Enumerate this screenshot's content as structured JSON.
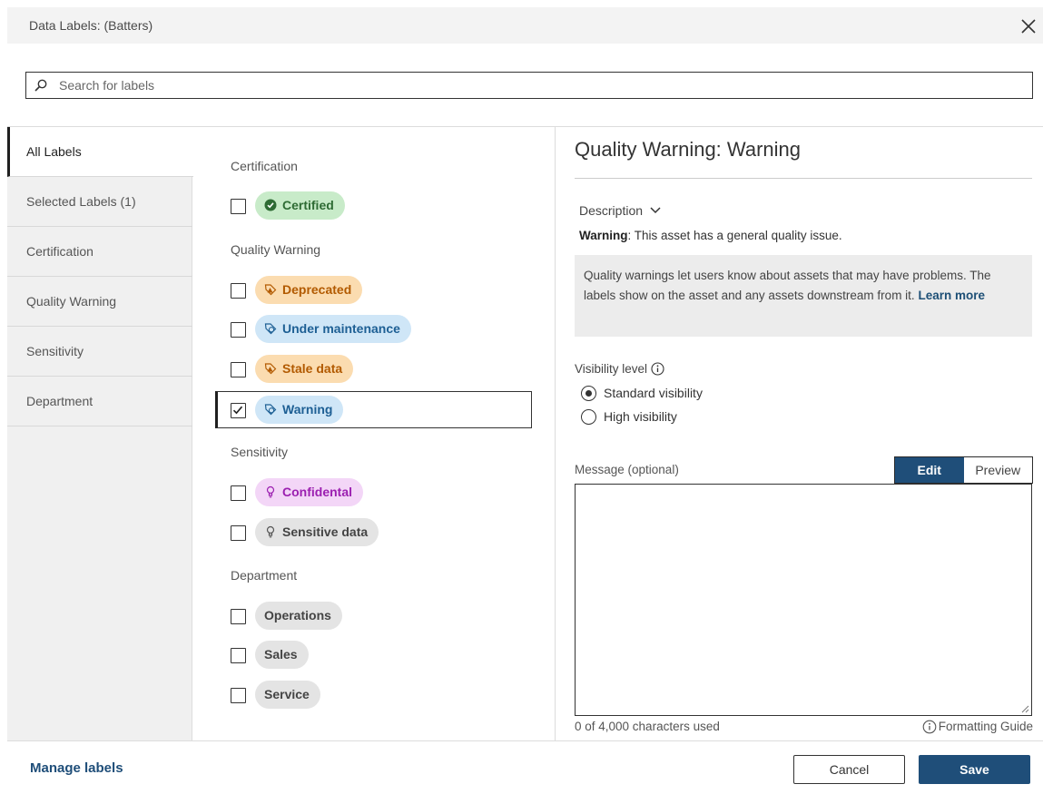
{
  "dialog": {
    "title": "Data Labels: (Batters)",
    "search_placeholder": "Search for labels"
  },
  "tabs": [
    {
      "label": "All Labels",
      "active": true
    },
    {
      "label": "Selected Labels (1)",
      "active": false
    },
    {
      "label": "Certification",
      "active": false
    },
    {
      "label": "Quality Warning",
      "active": false
    },
    {
      "label": "Sensitivity",
      "active": false
    },
    {
      "label": "Department",
      "active": false
    }
  ],
  "groups": {
    "certification": {
      "heading": "Certification",
      "labels": [
        {
          "text": "Certified",
          "checked": false,
          "icon": "check-circle-icon",
          "color": "#2e6b34"
        }
      ]
    },
    "quality_warning": {
      "heading": "Quality Warning",
      "labels": [
        {
          "text": "Deprecated",
          "checked": false,
          "icon": "warning-tag-icon",
          "color": "#b25a00"
        },
        {
          "text": "Under maintenance",
          "checked": false,
          "icon": "info-tag-icon",
          "color": "#1d5f94"
        },
        {
          "text": "Stale data",
          "checked": false,
          "icon": "warning-tag-icon",
          "color": "#b25a00"
        },
        {
          "text": "Warning",
          "checked": true,
          "icon": "info-tag-icon",
          "color": "#1d5f94"
        }
      ]
    },
    "sensitivity": {
      "heading": "Sensitivity",
      "labels": [
        {
          "text": "Confidental",
          "checked": false,
          "icon": "lightbulb-icon",
          "color": "#9b1fb0"
        },
        {
          "text": "Sensitive data",
          "checked": false,
          "icon": "lightbulb-icon",
          "color": "#444444"
        }
      ]
    },
    "department": {
      "heading": "Department",
      "labels": [
        {
          "text": "Operations",
          "checked": false
        },
        {
          "text": "Sales",
          "checked": false
        },
        {
          "text": "Service",
          "checked": false
        }
      ]
    }
  },
  "details": {
    "title": "Quality Warning: Warning",
    "description_toggle": "Description",
    "description_label": "Warning",
    "description_text": ": This asset has a general quality issue.",
    "info_text": "Quality warnings let users know about assets that may have problems. The labels show on the asset and any assets downstream from it.",
    "learn_more": "Learn more",
    "visibility_label": "Visibility level",
    "visibility_options": [
      {
        "label": "Standard visibility",
        "selected": true
      },
      {
        "label": "High visibility",
        "selected": false
      }
    ],
    "message_label": "Message (optional)",
    "edit_label": "Edit",
    "preview_label": "Preview",
    "message_value": "",
    "char_count": "0 of 4,000 characters used",
    "formatting_guide": "Formatting Guide"
  },
  "footer": {
    "manage_labels": "Manage labels",
    "cancel": "Cancel",
    "save": "Save"
  },
  "colors": {
    "accent": "#1f4e79",
    "certified_bg": "#c8ebc9",
    "warning_orange_bg": "#fbdcb0",
    "warning_blue_bg": "#cfe6f7",
    "sensitivity_purple_bg": "#f3d6f7",
    "neutral_chip_bg": "#e4e4e4"
  }
}
